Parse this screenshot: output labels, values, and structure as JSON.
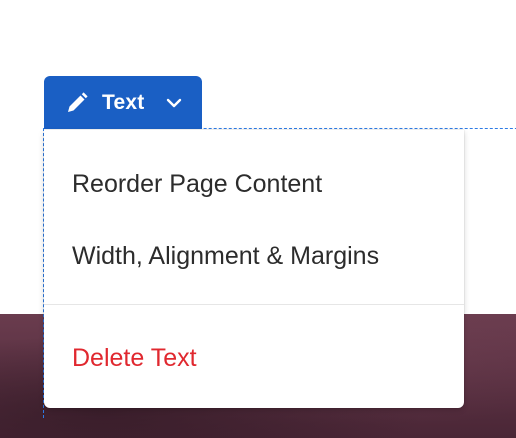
{
  "chip": {
    "label": "Text",
    "icon": "pencil-icon",
    "dropdown_icon": "chevron-down-icon",
    "color": "#1a5fc4"
  },
  "menu": {
    "items": [
      {
        "label": "Reorder Page Content"
      },
      {
        "label": "Width, Alignment & Margins"
      }
    ],
    "destructive_item": {
      "label": "Delete Text",
      "color": "#e0282f"
    }
  },
  "selection": {
    "outline_color": "#2d7be5"
  }
}
